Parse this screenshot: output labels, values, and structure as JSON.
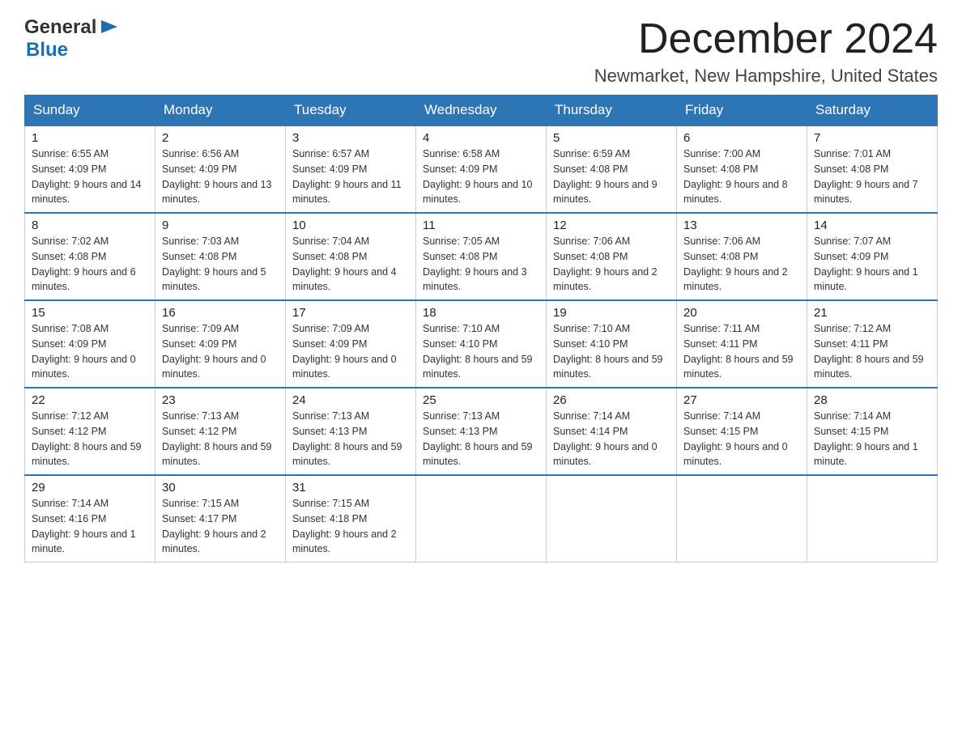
{
  "header": {
    "logo_general": "General",
    "logo_blue": "Blue",
    "month": "December 2024",
    "location": "Newmarket, New Hampshire, United States"
  },
  "days_of_week": [
    "Sunday",
    "Monday",
    "Tuesday",
    "Wednesday",
    "Thursday",
    "Friday",
    "Saturday"
  ],
  "weeks": [
    [
      {
        "day": "1",
        "sunrise": "Sunrise: 6:55 AM",
        "sunset": "Sunset: 4:09 PM",
        "daylight": "Daylight: 9 hours and 14 minutes."
      },
      {
        "day": "2",
        "sunrise": "Sunrise: 6:56 AM",
        "sunset": "Sunset: 4:09 PM",
        "daylight": "Daylight: 9 hours and 13 minutes."
      },
      {
        "day": "3",
        "sunrise": "Sunrise: 6:57 AM",
        "sunset": "Sunset: 4:09 PM",
        "daylight": "Daylight: 9 hours and 11 minutes."
      },
      {
        "day": "4",
        "sunrise": "Sunrise: 6:58 AM",
        "sunset": "Sunset: 4:09 PM",
        "daylight": "Daylight: 9 hours and 10 minutes."
      },
      {
        "day": "5",
        "sunrise": "Sunrise: 6:59 AM",
        "sunset": "Sunset: 4:08 PM",
        "daylight": "Daylight: 9 hours and 9 minutes."
      },
      {
        "day": "6",
        "sunrise": "Sunrise: 7:00 AM",
        "sunset": "Sunset: 4:08 PM",
        "daylight": "Daylight: 9 hours and 8 minutes."
      },
      {
        "day": "7",
        "sunrise": "Sunrise: 7:01 AM",
        "sunset": "Sunset: 4:08 PM",
        "daylight": "Daylight: 9 hours and 7 minutes."
      }
    ],
    [
      {
        "day": "8",
        "sunrise": "Sunrise: 7:02 AM",
        "sunset": "Sunset: 4:08 PM",
        "daylight": "Daylight: 9 hours and 6 minutes."
      },
      {
        "day": "9",
        "sunrise": "Sunrise: 7:03 AM",
        "sunset": "Sunset: 4:08 PM",
        "daylight": "Daylight: 9 hours and 5 minutes."
      },
      {
        "day": "10",
        "sunrise": "Sunrise: 7:04 AM",
        "sunset": "Sunset: 4:08 PM",
        "daylight": "Daylight: 9 hours and 4 minutes."
      },
      {
        "day": "11",
        "sunrise": "Sunrise: 7:05 AM",
        "sunset": "Sunset: 4:08 PM",
        "daylight": "Daylight: 9 hours and 3 minutes."
      },
      {
        "day": "12",
        "sunrise": "Sunrise: 7:06 AM",
        "sunset": "Sunset: 4:08 PM",
        "daylight": "Daylight: 9 hours and 2 minutes."
      },
      {
        "day": "13",
        "sunrise": "Sunrise: 7:06 AM",
        "sunset": "Sunset: 4:08 PM",
        "daylight": "Daylight: 9 hours and 2 minutes."
      },
      {
        "day": "14",
        "sunrise": "Sunrise: 7:07 AM",
        "sunset": "Sunset: 4:09 PM",
        "daylight": "Daylight: 9 hours and 1 minute."
      }
    ],
    [
      {
        "day": "15",
        "sunrise": "Sunrise: 7:08 AM",
        "sunset": "Sunset: 4:09 PM",
        "daylight": "Daylight: 9 hours and 0 minutes."
      },
      {
        "day": "16",
        "sunrise": "Sunrise: 7:09 AM",
        "sunset": "Sunset: 4:09 PM",
        "daylight": "Daylight: 9 hours and 0 minutes."
      },
      {
        "day": "17",
        "sunrise": "Sunrise: 7:09 AM",
        "sunset": "Sunset: 4:09 PM",
        "daylight": "Daylight: 9 hours and 0 minutes."
      },
      {
        "day": "18",
        "sunrise": "Sunrise: 7:10 AM",
        "sunset": "Sunset: 4:10 PM",
        "daylight": "Daylight: 8 hours and 59 minutes."
      },
      {
        "day": "19",
        "sunrise": "Sunrise: 7:10 AM",
        "sunset": "Sunset: 4:10 PM",
        "daylight": "Daylight: 8 hours and 59 minutes."
      },
      {
        "day": "20",
        "sunrise": "Sunrise: 7:11 AM",
        "sunset": "Sunset: 4:11 PM",
        "daylight": "Daylight: 8 hours and 59 minutes."
      },
      {
        "day": "21",
        "sunrise": "Sunrise: 7:12 AM",
        "sunset": "Sunset: 4:11 PM",
        "daylight": "Daylight: 8 hours and 59 minutes."
      }
    ],
    [
      {
        "day": "22",
        "sunrise": "Sunrise: 7:12 AM",
        "sunset": "Sunset: 4:12 PM",
        "daylight": "Daylight: 8 hours and 59 minutes."
      },
      {
        "day": "23",
        "sunrise": "Sunrise: 7:13 AM",
        "sunset": "Sunset: 4:12 PM",
        "daylight": "Daylight: 8 hours and 59 minutes."
      },
      {
        "day": "24",
        "sunrise": "Sunrise: 7:13 AM",
        "sunset": "Sunset: 4:13 PM",
        "daylight": "Daylight: 8 hours and 59 minutes."
      },
      {
        "day": "25",
        "sunrise": "Sunrise: 7:13 AM",
        "sunset": "Sunset: 4:13 PM",
        "daylight": "Daylight: 8 hours and 59 minutes."
      },
      {
        "day": "26",
        "sunrise": "Sunrise: 7:14 AM",
        "sunset": "Sunset: 4:14 PM",
        "daylight": "Daylight: 9 hours and 0 minutes."
      },
      {
        "day": "27",
        "sunrise": "Sunrise: 7:14 AM",
        "sunset": "Sunset: 4:15 PM",
        "daylight": "Daylight: 9 hours and 0 minutes."
      },
      {
        "day": "28",
        "sunrise": "Sunrise: 7:14 AM",
        "sunset": "Sunset: 4:15 PM",
        "daylight": "Daylight: 9 hours and 1 minute."
      }
    ],
    [
      {
        "day": "29",
        "sunrise": "Sunrise: 7:14 AM",
        "sunset": "Sunset: 4:16 PM",
        "daylight": "Daylight: 9 hours and 1 minute."
      },
      {
        "day": "30",
        "sunrise": "Sunrise: 7:15 AM",
        "sunset": "Sunset: 4:17 PM",
        "daylight": "Daylight: 9 hours and 2 minutes."
      },
      {
        "day": "31",
        "sunrise": "Sunrise: 7:15 AM",
        "sunset": "Sunset: 4:18 PM",
        "daylight": "Daylight: 9 hours and 2 minutes."
      },
      null,
      null,
      null,
      null
    ]
  ]
}
